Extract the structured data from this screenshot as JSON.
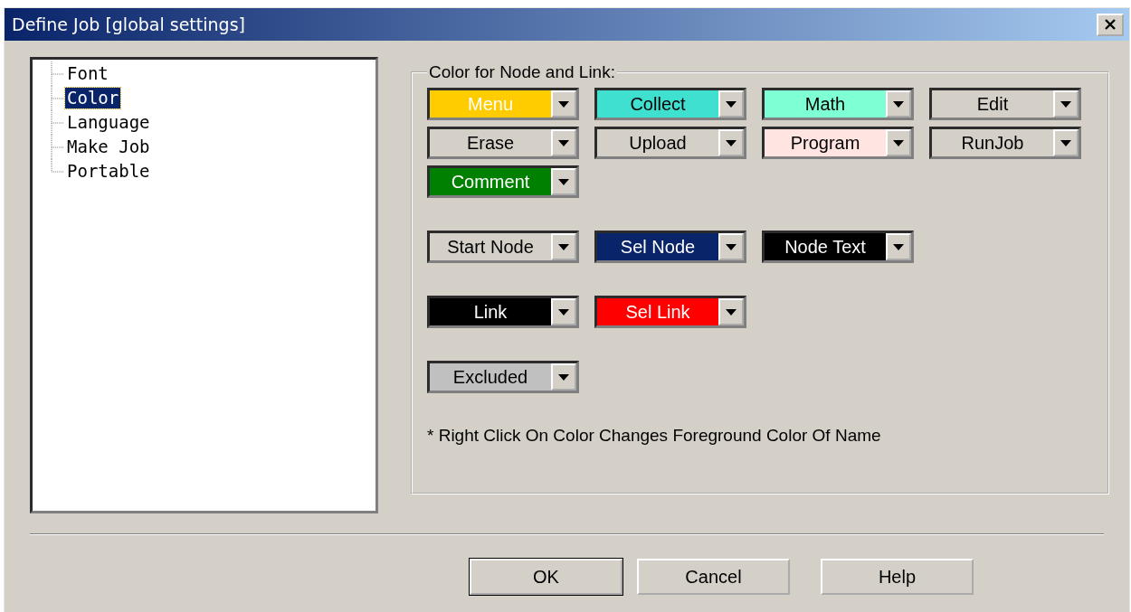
{
  "window": {
    "title": "Define Job [global settings]"
  },
  "tree": {
    "items": [
      {
        "label": "Font",
        "selected": false
      },
      {
        "label": "Color",
        "selected": true
      },
      {
        "label": "Language",
        "selected": false
      },
      {
        "label": "Make Job",
        "selected": false
      },
      {
        "label": "Portable",
        "selected": false
      }
    ]
  },
  "color_group": {
    "legend": "Color for Node and Link:",
    "sections": [
      {
        "pickers": [
          {
            "label": "Menu",
            "color": "#ffcc00",
            "kind": "light"
          },
          {
            "label": "Collect",
            "color": "#40e0d0",
            "kind": "dark"
          },
          {
            "label": "Math",
            "color": "#7fffd4",
            "kind": "dark"
          },
          {
            "label": "Edit",
            "color": "#d4d0c8",
            "kind": "dark"
          },
          {
            "label": "Erase",
            "color": "#d4d0c8",
            "kind": "dark"
          },
          {
            "label": "Upload",
            "color": "#d4d0c8",
            "kind": "dark"
          },
          {
            "label": "Program",
            "color": "#ffe4e1",
            "kind": "dark"
          },
          {
            "label": "RunJob",
            "color": "#d4d0c8",
            "kind": "dark"
          },
          {
            "label": "Comment",
            "color": "#008000",
            "kind": "light"
          }
        ]
      },
      {
        "pickers": [
          {
            "label": "Start Node",
            "color": "#d4d0c8",
            "kind": "dark"
          },
          {
            "label": "Sel Node",
            "color": "#0a246a",
            "kind": "light"
          },
          {
            "label": "Node Text",
            "color": "#000000",
            "kind": "light"
          }
        ]
      },
      {
        "pickers": [
          {
            "label": "Link",
            "color": "#000000",
            "kind": "light"
          },
          {
            "label": "Sel Link",
            "color": "#ff0000",
            "kind": "light"
          }
        ]
      },
      {
        "pickers": [
          {
            "label": "Excluded",
            "color": "#c0c0c0",
            "kind": "dark"
          }
        ]
      }
    ],
    "note": "* Right Click On Color Changes Foreground Color Of Name"
  },
  "buttons": [
    {
      "label": "OK",
      "default": true
    },
    {
      "label": "Cancel",
      "default": false
    },
    {
      "label": "Help",
      "default": false
    }
  ]
}
